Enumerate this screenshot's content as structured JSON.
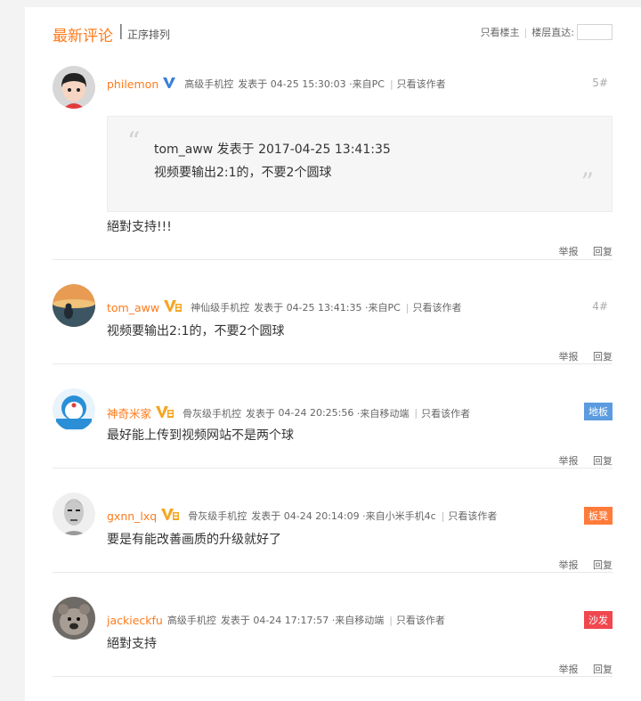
{
  "header": {
    "title": "最新评论",
    "separator": "|",
    "sort_label": "正序排列",
    "only_author": "只看楼主",
    "divider": "|",
    "floor_jump": "楼层直达:"
  },
  "common": {
    "posted_at": "发表于",
    "only_this_author": "只看该作者",
    "report": "举报",
    "reply": "回复",
    "pipe": "|"
  },
  "comments": [
    {
      "user": "philemon",
      "level": "高级手机控",
      "time": "04-25 15:30:03",
      "source": "·来自PC",
      "floor": "5#",
      "quote_author_line": "tom_aww 发表于 2017-04-25 13:41:35",
      "quote_text": "视频要输出2:1的，不要2个圆球",
      "content": "絕對支持!!!"
    },
    {
      "user": "tom_aww",
      "level": "神仙级手机控",
      "time": "04-25 13:41:35",
      "source": "·来自PC",
      "floor": "4#",
      "content": "视频要输出2:1的，不要2个圆球"
    },
    {
      "user": "神奇米家",
      "level": "骨灰级手机控",
      "time": "04-24 20:25:56",
      "source": "·来自移动端",
      "tag": "地板",
      "tag_color": "#5b9be0",
      "content": "最好能上传到视频网站不是两个球"
    },
    {
      "user": "gxnn_lxq",
      "level": "骨灰级手机控",
      "time": "04-24 20:14:09",
      "source": "·来自小米手机4c",
      "tag": "板凳",
      "tag_color": "#ff7b3a",
      "content": "要是有能改善画质的升级就好了"
    },
    {
      "user": "jackieckfu",
      "level": "高级手机控",
      "time": "04-24 17:17:57",
      "source": "·来自移动端",
      "tag": "沙发",
      "tag_color": "#f0474f",
      "content": "絕對支持"
    }
  ],
  "colors": {
    "accent": "#ff7a1a",
    "verified_blue": "#3b7fd9",
    "vip_gold": "#f5a623"
  },
  "icons": {
    "verified": "verified-v-icon",
    "vip": "vip-v-icon",
    "quote_open": "quote-open-icon",
    "quote_close": "quote-close-icon"
  }
}
